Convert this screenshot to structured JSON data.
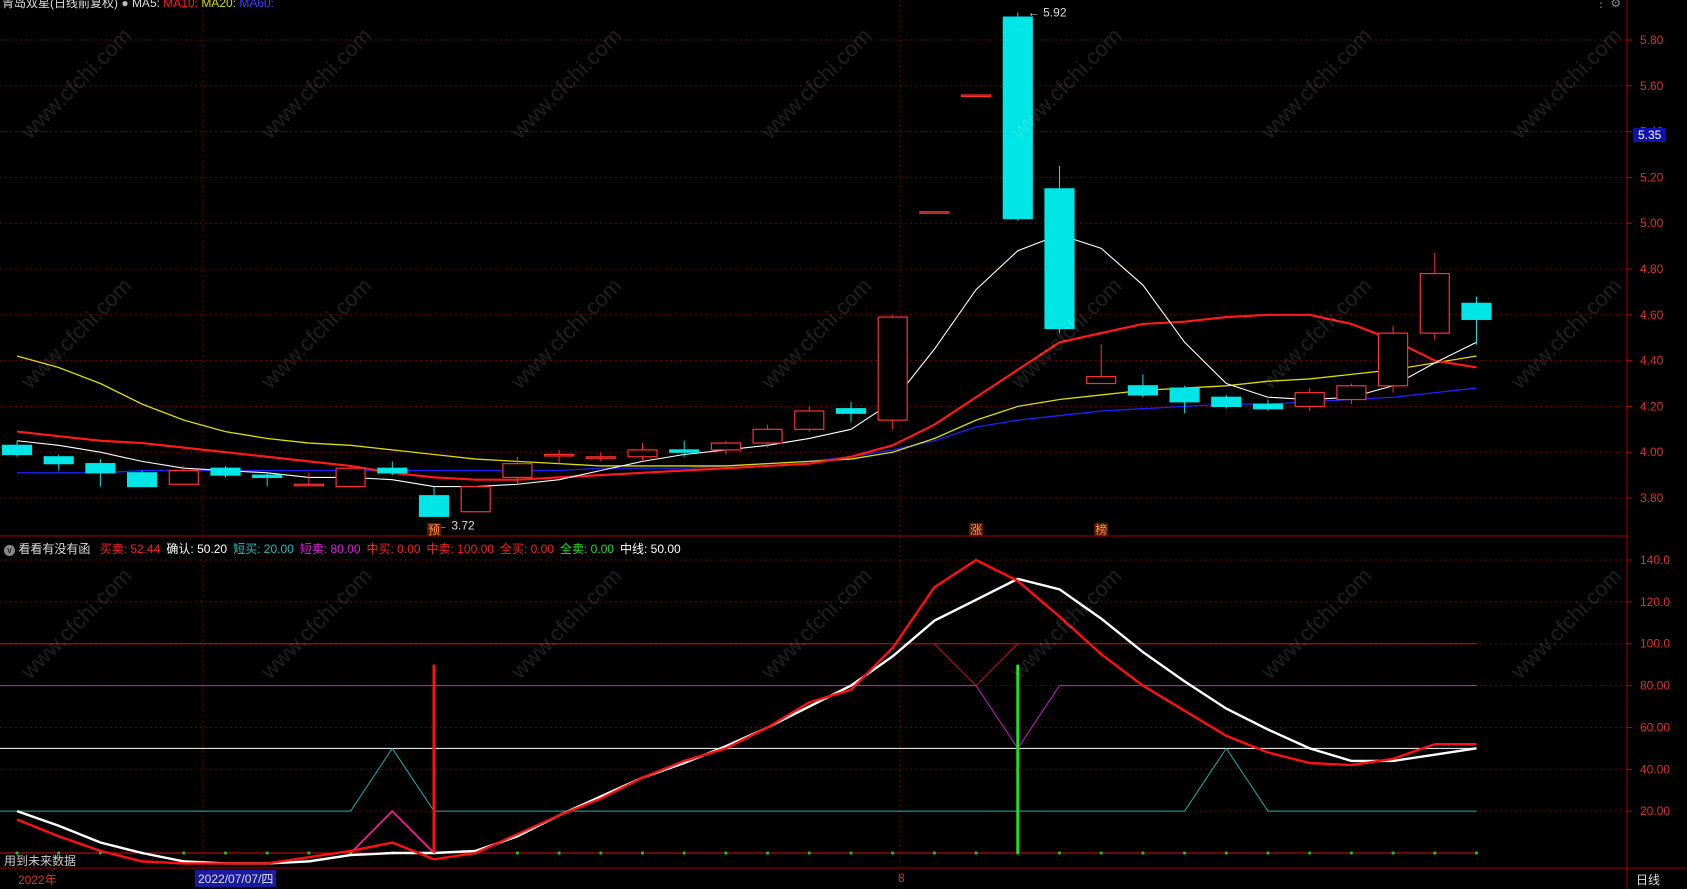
{
  "header": {
    "title": "青岛双星(日线前复权)",
    "indicator": "MA5:",
    "ma_labels": [
      "MA10: ",
      "MA20: ",
      "MA60: "
    ]
  },
  "sub_header": {
    "title": "看看有没有函",
    "items": [
      {
        "label": "买卖: 52.44",
        "color": "#ff2020"
      },
      {
        "label": "确认: 50.20",
        "color": "#ffffff"
      },
      {
        "label": "短买: 20.00",
        "color": "#20c0c0"
      },
      {
        "label": "短卖: 80.00",
        "color": "#e020e0"
      },
      {
        "label": "中买: 0.00",
        "color": "#ff2020"
      },
      {
        "label": "中卖: 100.00",
        "color": "#ff2020"
      },
      {
        "label": "全买: 0.00",
        "color": "#ff2020"
      },
      {
        "label": "全卖: 0.00",
        "color": "#20e020"
      },
      {
        "label": "中线: 50.00",
        "color": "#ffffff"
      }
    ]
  },
  "price_axis": [
    "5.80",
    "5.60",
    "5.40",
    "5.20",
    "5.00",
    "4.80",
    "4.60",
    "4.40",
    "4.20",
    "4.00",
    "3.80"
  ],
  "current_price": "5.35",
  "osc_axis": [
    "140.0",
    "120.0",
    "100.0",
    "80.00",
    "60.00",
    "40.00",
    "20.00"
  ],
  "annotations": {
    "high": "5.92",
    "low": "3.72",
    "marks": [
      "预",
      "涨",
      "榜"
    ]
  },
  "footer": {
    "year": "2022年",
    "date": "2022/07/07/四",
    "month": "8",
    "period": "日线",
    "note": "用到未来数据"
  },
  "watermark": "www.cfchi.com",
  "colors": {
    "up": "#ff3030",
    "down": "#00e5e5",
    "ma5": "#ffffff",
    "ma10": "#ff1a1a",
    "ma20": "#dddd00",
    "ma60": "#2020ff",
    "grid": "#7a0000"
  },
  "chart_data": [
    {
      "type": "candlestick",
      "ylim": [
        3.65,
        5.92
      ],
      "candles": [
        {
          "o": 4.03,
          "h": 4.05,
          "l": 3.98,
          "c": 3.99
        },
        {
          "o": 3.98,
          "h": 3.99,
          "l": 3.92,
          "c": 3.95
        },
        {
          "o": 3.95,
          "h": 3.97,
          "l": 3.85,
          "c": 3.91
        },
        {
          "o": 3.91,
          "h": 3.92,
          "l": 3.85,
          "c": 3.85
        },
        {
          "o": 3.86,
          "h": 3.94,
          "l": 3.86,
          "c": 3.92
        },
        {
          "o": 3.93,
          "h": 3.94,
          "l": 3.89,
          "c": 3.9
        },
        {
          "o": 3.9,
          "h": 3.91,
          "l": 3.85,
          "c": 3.89
        },
        {
          "o": 3.86,
          "h": 3.91,
          "l": 3.85,
          "c": 3.86
        },
        {
          "o": 3.85,
          "h": 3.94,
          "l": 3.85,
          "c": 3.93
        },
        {
          "o": 3.93,
          "h": 3.96,
          "l": 3.9,
          "c": 3.91
        },
        {
          "o": 3.81,
          "h": 3.85,
          "l": 3.72,
          "c": 3.72
        },
        {
          "o": 3.74,
          "h": 3.85,
          "l": 3.74,
          "c": 3.85
        },
        {
          "o": 3.89,
          "h": 3.98,
          "l": 3.86,
          "c": 3.95
        },
        {
          "o": 3.99,
          "h": 4.01,
          "l": 3.95,
          "c": 3.99
        },
        {
          "o": 3.98,
          "h": 4.0,
          "l": 3.96,
          "c": 3.98
        },
        {
          "o": 3.98,
          "h": 4.04,
          "l": 3.96,
          "c": 4.01
        },
        {
          "o": 4.01,
          "h": 4.05,
          "l": 3.98,
          "c": 4.0
        },
        {
          "o": 4.01,
          "h": 4.05,
          "l": 3.99,
          "c": 4.04
        },
        {
          "o": 4.04,
          "h": 4.12,
          "l": 4.02,
          "c": 4.1
        },
        {
          "o": 4.1,
          "h": 4.2,
          "l": 4.09,
          "c": 4.18
        },
        {
          "o": 4.19,
          "h": 4.22,
          "l": 4.13,
          "c": 4.17
        },
        {
          "o": 4.14,
          "h": 4.6,
          "l": 4.1,
          "c": 4.59
        },
        {
          "o": 5.05,
          "h": 5.05,
          "l": 5.05,
          "c": 5.05
        },
        {
          "o": 5.56,
          "h": 5.56,
          "l": 5.56,
          "c": 5.56
        },
        {
          "o": 5.9,
          "h": 5.92,
          "l": 5.01,
          "c": 5.02
        },
        {
          "o": 5.15,
          "h": 5.25,
          "l": 4.52,
          "c": 4.54
        },
        {
          "o": 4.3,
          "h": 4.47,
          "l": 4.3,
          "c": 4.33
        },
        {
          "o": 4.29,
          "h": 4.34,
          "l": 4.24,
          "c": 4.25
        },
        {
          "o": 4.28,
          "h": 4.29,
          "l": 4.17,
          "c": 4.22
        },
        {
          "o": 4.24,
          "h": 4.25,
          "l": 4.19,
          "c": 4.2
        },
        {
          "o": 4.21,
          "h": 4.23,
          "l": 4.18,
          "c": 4.19
        },
        {
          "o": 4.2,
          "h": 4.28,
          "l": 4.18,
          "c": 4.26
        },
        {
          "o": 4.23,
          "h": 4.3,
          "l": 4.21,
          "c": 4.29
        },
        {
          "o": 4.29,
          "h": 4.55,
          "l": 4.26,
          "c": 4.52
        },
        {
          "o": 4.52,
          "h": 4.87,
          "l": 4.49,
          "c": 4.78
        },
        {
          "o": 4.65,
          "h": 4.68,
          "l": 4.47,
          "c": 4.58
        }
      ],
      "ma5": [
        4.05,
        4.03,
        4.0,
        3.96,
        3.93,
        3.92,
        3.91,
        3.89,
        3.89,
        3.88,
        3.85,
        3.85,
        3.86,
        3.88,
        3.92,
        3.96,
        3.99,
        4.01,
        4.03,
        4.06,
        4.1,
        4.22,
        4.45,
        4.71,
        4.88,
        4.95,
        4.89,
        4.73,
        4.48,
        4.3,
        4.24,
        4.23,
        4.24,
        4.29,
        4.39,
        4.48
      ],
      "ma10": [
        4.09,
        4.07,
        4.05,
        4.04,
        4.02,
        4.0,
        3.98,
        3.96,
        3.94,
        3.91,
        3.89,
        3.88,
        3.88,
        3.89,
        3.9,
        3.91,
        3.92,
        3.93,
        3.94,
        3.95,
        3.98,
        4.03,
        4.12,
        4.24,
        4.36,
        4.48,
        4.52,
        4.56,
        4.57,
        4.59,
        4.6,
        4.6,
        4.56,
        4.49,
        4.4,
        4.37
      ],
      "ma20": [
        4.42,
        4.37,
        4.3,
        4.21,
        4.14,
        4.09,
        4.06,
        4.04,
        4.03,
        4.01,
        3.99,
        3.97,
        3.96,
        3.95,
        3.94,
        3.94,
        3.94,
        3.94,
        3.95,
        3.96,
        3.97,
        4.0,
        4.06,
        4.14,
        4.2,
        4.23,
        4.25,
        4.27,
        4.28,
        4.29,
        4.31,
        4.32,
        4.34,
        4.36,
        4.39,
        4.42
      ],
      "ma60": [
        3.91,
        3.91,
        3.91,
        3.92,
        3.92,
        3.92,
        3.92,
        3.92,
        3.92,
        3.92,
        3.92,
        3.92,
        3.92,
        3.92,
        3.93,
        3.93,
        3.93,
        3.94,
        3.95,
        3.96,
        3.98,
        4.01,
        4.05,
        4.11,
        4.14,
        4.16,
        4.18,
        4.19,
        4.2,
        4.21,
        4.21,
        4.22,
        4.23,
        4.24,
        4.26,
        4.28
      ]
    },
    {
      "type": "line",
      "ylim": [
        0,
        140
      ],
      "series": [
        {
          "name": "买卖",
          "values": [
            16,
            8,
            1,
            -4,
            -5,
            -5,
            -5,
            -2,
            1,
            5,
            -3,
            0,
            9,
            18,
            26,
            36,
            44,
            50,
            60,
            72,
            78,
            98,
            127,
            140,
            130,
            113,
            95,
            80,
            68,
            56,
            48,
            43,
            42,
            45,
            52,
            52
          ]
        },
        {
          "name": "确认",
          "values": [
            20,
            13,
            5,
            0,
            -4,
            -5,
            -5,
            -4,
            -1,
            0,
            0,
            1,
            8,
            18,
            27,
            36,
            43,
            51,
            60,
            70,
            80,
            94,
            111,
            121,
            131,
            126,
            112,
            96,
            82,
            69,
            59,
            50,
            44,
            44,
            47,
            50
          ]
        }
      ],
      "reference_lines": {
        "中卖": 100,
        "短卖": 80,
        "中线": 50,
        "短买": 20,
        "中买": 0
      }
    }
  ]
}
